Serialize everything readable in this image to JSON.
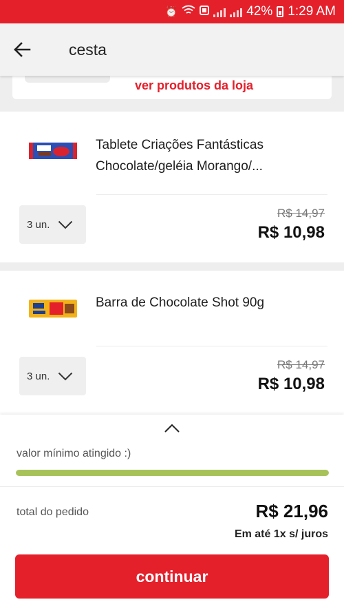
{
  "status_bar": {
    "battery": "42%",
    "time": "1:29 AM",
    "icons": [
      "alarm-icon",
      "wifi-icon",
      "cast-icon",
      "signal-icon",
      "battery-icon"
    ]
  },
  "app_bar": {
    "title": "cesta",
    "back_icon": "arrow-left-icon"
  },
  "store": {
    "link_label": "ver produtos da loja"
  },
  "products": [
    {
      "name_line1": "Tablete Criações Fantásticas",
      "name_line2": "Chocolate/geléia Morango/...",
      "quantity": "3 un.",
      "old_price": "R$ 14,97",
      "price": "R$ 10,98",
      "thumb_colors": {
        "wrapper": "#2b4fb5",
        "accent": "#d9232e",
        "label": "#ffffff"
      }
    },
    {
      "name_line1": "Barra de Chocolate Shot 90g",
      "quantity": "3 un.",
      "old_price": "R$ 14,97",
      "price": "R$ 10,98",
      "thumb_colors": {
        "wrapper": "#f2b21a",
        "accent": "#1c3f8f",
        "label": "#e4202b"
      }
    }
  ],
  "summary": {
    "minimum_text": "valor mínimo atingido :)",
    "minimum_progress": 1.0,
    "total_label": "total do pedido",
    "total_value": "R$ 21,96",
    "installments": "Em até 1x s/ juros",
    "continue_label": "continuar"
  },
  "colors": {
    "brand_red": "#e4202b",
    "progress_green": "#a8c25a",
    "background": "#eeeeee"
  }
}
